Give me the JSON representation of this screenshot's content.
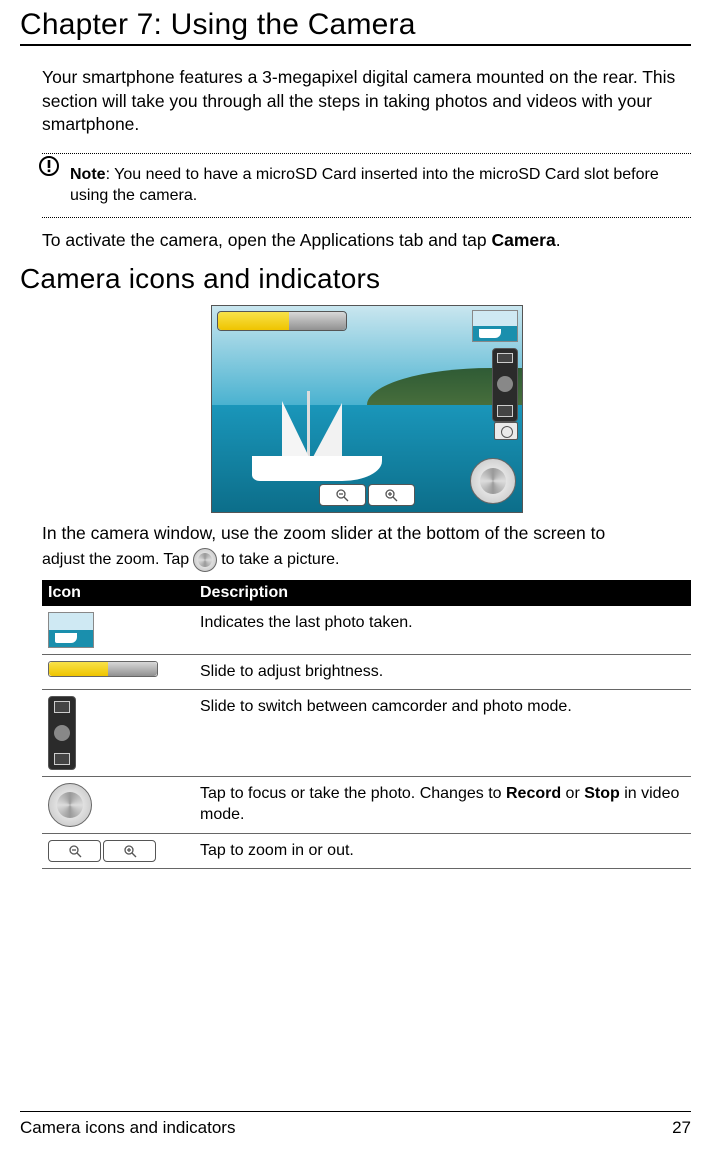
{
  "chapter_title": "Chapter 7: Using the Camera",
  "intro": "Your smartphone features a 3-megapixel digital camera mounted on the rear. This section will take you through all the steps in taking photos and videos with your smartphone.",
  "note": {
    "label": "Note",
    "text": ": You need to have a microSD Card inserted into the microSD Card slot before using the camera."
  },
  "activate": {
    "pre": "To activate the camera, open the Applications tab and tap ",
    "bold": "Camera",
    "post": "."
  },
  "section_title": "Camera icons and indicators",
  "zoom_instr": {
    "line1": "In the camera window, use the zoom slider at the bottom of the screen to",
    "line2a": "adjust the zoom. ",
    "line2b": "Tap ",
    "line2c": " to take a picture."
  },
  "table": {
    "headers": {
      "icon": "Icon",
      "desc": "Description"
    },
    "rows": [
      {
        "desc": "Indicates the last photo taken."
      },
      {
        "desc": "Slide to adjust brightness."
      },
      {
        "desc": "Slide to switch between camcorder and photo mode."
      },
      {
        "desc_pre": "Tap to focus or take the photo. Changes to ",
        "b1": "Record",
        "mid": " or ",
        "b2": "Stop",
        "desc_post": " in video mode."
      },
      {
        "desc": "Tap to zoom in or out."
      }
    ]
  },
  "footer": {
    "section": "Camera icons and indicators",
    "page": "27"
  }
}
